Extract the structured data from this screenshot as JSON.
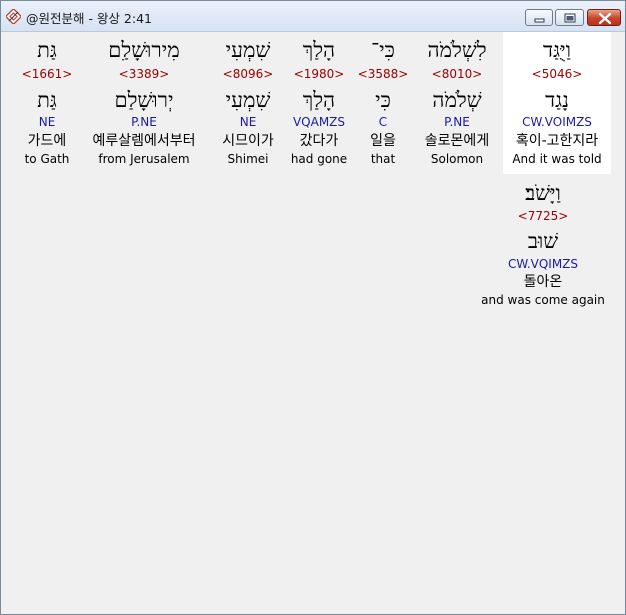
{
  "window": {
    "title": "@원전분해 - 왕상 2:41",
    "icon": "bible-app-icon"
  },
  "words": [
    {
      "hebrew": "וַיֻּגַּד",
      "strong": "<5046>",
      "lemma": "נָגַד",
      "morph": "CW.VOIMZS",
      "korean": "혹이-고한지라",
      "english": "And it was told",
      "selected": true
    },
    {
      "hebrew": "לִשְׁלֹמֹה",
      "strong": "<8010>",
      "lemma": "שְׁלֹמֹה",
      "morph": "P.NE",
      "korean": "솔로몬에게",
      "english": "Solomon",
      "selected": false
    },
    {
      "hebrew": "כִּי־",
      "strong": "<3588>",
      "lemma": "כִּי",
      "morph": "C",
      "korean": "일을",
      "english": "that",
      "selected": false
    },
    {
      "hebrew": "הָלַךְ",
      "strong": "<1980>",
      "lemma": "הָלַךְ",
      "morph": "VQAMZS",
      "korean": "갔다가",
      "english": "had gone",
      "selected": false
    },
    {
      "hebrew": "שִׁמְעִי",
      "strong": "<8096>",
      "lemma": "שִׁמְעִי",
      "morph": "NE",
      "korean": "시므이가",
      "english": "Shimei",
      "selected": false
    },
    {
      "hebrew": "מִירוּשָׁלִַם",
      "strong": "<3389>",
      "lemma": "יְרוּשָׁלַם",
      "morph": "P.NE",
      "korean": "예루살렘에서부터",
      "english": "from Jerusalem",
      "selected": false
    },
    {
      "hebrew": "גַּת",
      "strong": "<1661>",
      "lemma": "גַּת",
      "morph": "NE",
      "korean": "가드에",
      "english": "to Gath",
      "selected": false
    },
    {
      "hebrew": "וַיָּשֹׁב׃",
      "strong": "<7725>",
      "lemma": "שׁוּב",
      "morph": "CW.VQIMZS",
      "korean": "돌아온",
      "english": "and was come again",
      "selected": false
    }
  ]
}
